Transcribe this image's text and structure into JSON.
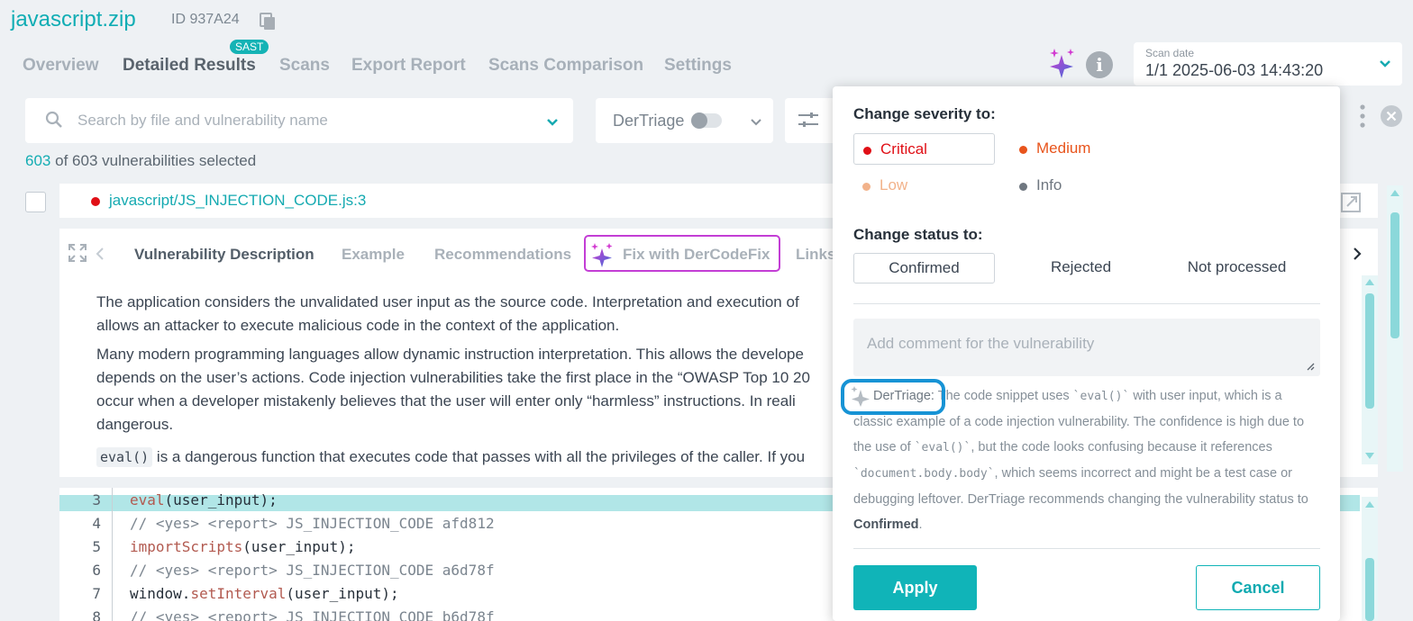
{
  "project": {
    "title": "javascript.zip",
    "id": "ID 937A24"
  },
  "tabs": [
    {
      "label": "Overview"
    },
    {
      "label": "Detailed Results",
      "badge": "SAST"
    },
    {
      "label": "Scans"
    },
    {
      "label": "Export Report"
    },
    {
      "label": "Scans Comparison"
    },
    {
      "label": "Settings"
    }
  ],
  "scan_date": {
    "label": "Scan date",
    "value": "1/1 2025-06-03 14:43:20"
  },
  "search": {
    "placeholder": "Search by file and vulnerability name"
  },
  "triage_toggle": {
    "label": "DerTriage",
    "on": false
  },
  "selection": {
    "selected": "603",
    "of": "of",
    "rest": "603 vulnerabilities selected"
  },
  "vulnerability": {
    "path": "javascript/JS_INJECTION_CODE.js:3",
    "severity_color": "#e00f16"
  },
  "detail_tabs": [
    {
      "label": "Vulnerability Description"
    },
    {
      "label": "Example"
    },
    {
      "label": "Recommendations"
    },
    {
      "label": "Fix with DerCodeFix"
    },
    {
      "label": "Links"
    }
  ],
  "description": {
    "p1_l1": "The application considers the unvalidated user input as the source code. Interpretation and execution of",
    "p1_l2": "allows an attacker to execute malicious code in the context of the application.",
    "p2_l1": "Many modern programming languages allow dynamic instruction interpretation. This allows the develope",
    "p2_l2": "depends on the user’s actions. Code injection vulnerabilities take the first place in the “OWASP Top 10 20",
    "p2_l3": "occur when a developer mistakenly believes that the user will enter only “harmless” instructions. In reali",
    "p2_l4": "dangerous.",
    "p3_code": "eval()",
    "p3_text": " is a dangerous function that executes code that passes with all the privileges of the caller. If you"
  },
  "code_lines": [
    {
      "n": "3",
      "fn": "eval",
      "rest": "(user_input);",
      "highlight": true
    },
    {
      "n": "4",
      "comment": "// <yes> <report> JS_INJECTION_CODE afd812"
    },
    {
      "n": "5",
      "fn": "importScripts",
      "rest": "(user_input);"
    },
    {
      "n": "6",
      "comment": "// <yes> <report> JS_INJECTION_CODE a6d78f"
    },
    {
      "n": "7",
      "pre": "window.",
      "fn": "setInterval",
      "rest": "(user_input);"
    },
    {
      "n": "8",
      "comment": "// <yes> <report> JS_INJECTION_CODE b6d78f"
    }
  ],
  "popup": {
    "severity_heading": "Change severity to:",
    "severities": [
      {
        "label": "Critical",
        "color": "#e00f16",
        "selected": true
      },
      {
        "label": "Medium",
        "color": "#e8541c"
      },
      {
        "label": "Low",
        "color": "#f2b28a"
      },
      {
        "label": "Info",
        "color": "#6f7780"
      }
    ],
    "status_heading": "Change status to:",
    "statuses": [
      {
        "label": "Confirmed",
        "selected": true
      },
      {
        "label": "Rejected"
      },
      {
        "label": "Not processed"
      }
    ],
    "comment_placeholder": "Add comment for the vulnerability",
    "triage": {
      "label": "DerTriage:",
      "t1": " The code snippet uses ",
      "c1": "`eval()`",
      "t2": " with user input, which is a classic example of a code injection vulnerability. The confidence is high due to the use of ",
      "c2": "`eval()`",
      "t3": ", but the code looks confusing because it references ",
      "c3": "`document.body.body`",
      "t4": ", which seems incorrect and might be a test case or debugging leftover. DerTriage recommends changing the vulnerability status to ",
      "status": "Confirmed",
      "t5": "."
    },
    "apply": "Apply",
    "cancel": "Cancel"
  },
  "colors": {
    "accent": "#10b4b8",
    "critical": "#e00f16",
    "ai_highlight": "#1793d5"
  }
}
